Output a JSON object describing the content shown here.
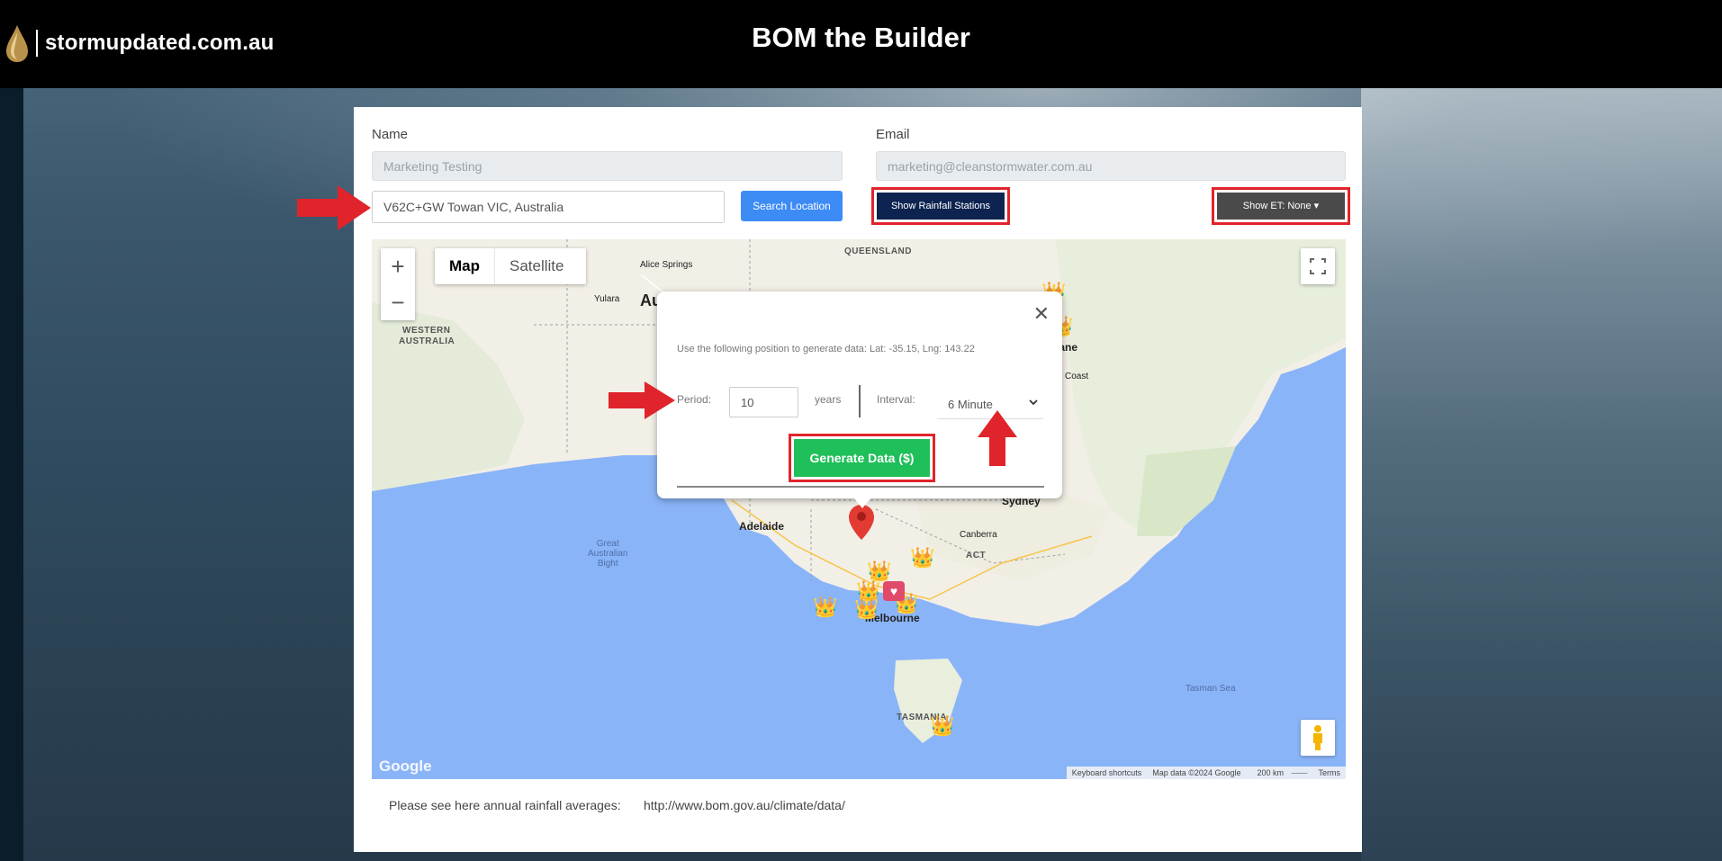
{
  "header": {
    "logo_text": "stormupdated.com.au",
    "title": "BOM the Builder"
  },
  "form": {
    "name_label": "Name",
    "name_value": "Marketing Testing",
    "email_label": "Email",
    "email_value": "marketing@cleanstormwater.com.au",
    "location_value": "V62C+GW Towan VIC, Australia",
    "search_button": "Search Location",
    "rain_button": "Show Rainfall Stations",
    "et_button": "Show ET: None"
  },
  "map": {
    "map_button": "Map",
    "satellite_button": "Satellite",
    "zoom_in": "+",
    "zoom_out": "−",
    "labels": {
      "queensland": "QUEENSLAND",
      "alice_springs": "Alice Springs",
      "yulara": "Yulara",
      "australia_partial": "Au",
      "western_australia_1": "WESTERN",
      "western_australia_2": "AUSTRALIA",
      "brisbane_partial": "bane",
      "coast_partial": "Coast",
      "sydney": "Sydney",
      "canberra": "Canberra",
      "act": "ACT",
      "adelaide": "Adelaide",
      "melbourne": "Melbourne",
      "tasmania": "TASMANIA",
      "bight_1": "Great",
      "bight_2": "Australian",
      "bight_3": "Bight",
      "tasman_sea": "Tasman Sea"
    },
    "google": "Google",
    "attribution": {
      "shortcuts": "Keyboard shortcuts",
      "data": "Map data ©2024 Google",
      "scale": "200 km",
      "terms": "Terms"
    }
  },
  "popup": {
    "close": "✕",
    "info": "Use the following position to generate data: Lat: -35.15, Lng: 143.22",
    "period_label": "Period:",
    "period_value": "10",
    "years_label": "years",
    "interval_label": "Interval:",
    "interval_value": "6 Minute",
    "generate_button": "Generate Data ($)"
  },
  "footer": {
    "label": "Please see here annual rainfall averages:",
    "link": "http://www.bom.gov.au/climate/data/"
  },
  "colors": {
    "annotation_red": "#e0242b",
    "search_blue": "#3d8bf5",
    "rain_navy": "#0d2451",
    "generate_green": "#1fbf59"
  }
}
